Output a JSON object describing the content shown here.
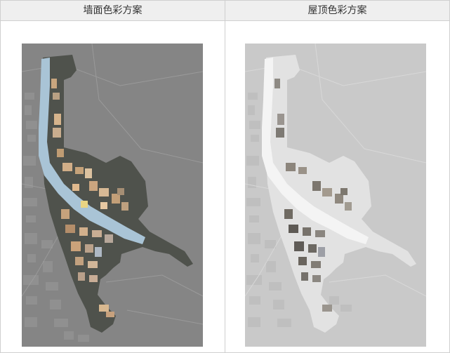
{
  "panels": [
    {
      "title": "墙面色彩方案"
    },
    {
      "title": "屋顶色彩方案"
    }
  ],
  "colors": {
    "header_bg": "#efefef",
    "border": "#cfcfcf",
    "left_map_bg": "#8a8a8a",
    "left_district": "#4f524c",
    "river": "#a9c4d6",
    "wall_warm": "#c8a57e",
    "right_map_bg": "#c9c9c9",
    "right_district": "#e2e2e2",
    "roof_dark": "#6f6a62"
  }
}
